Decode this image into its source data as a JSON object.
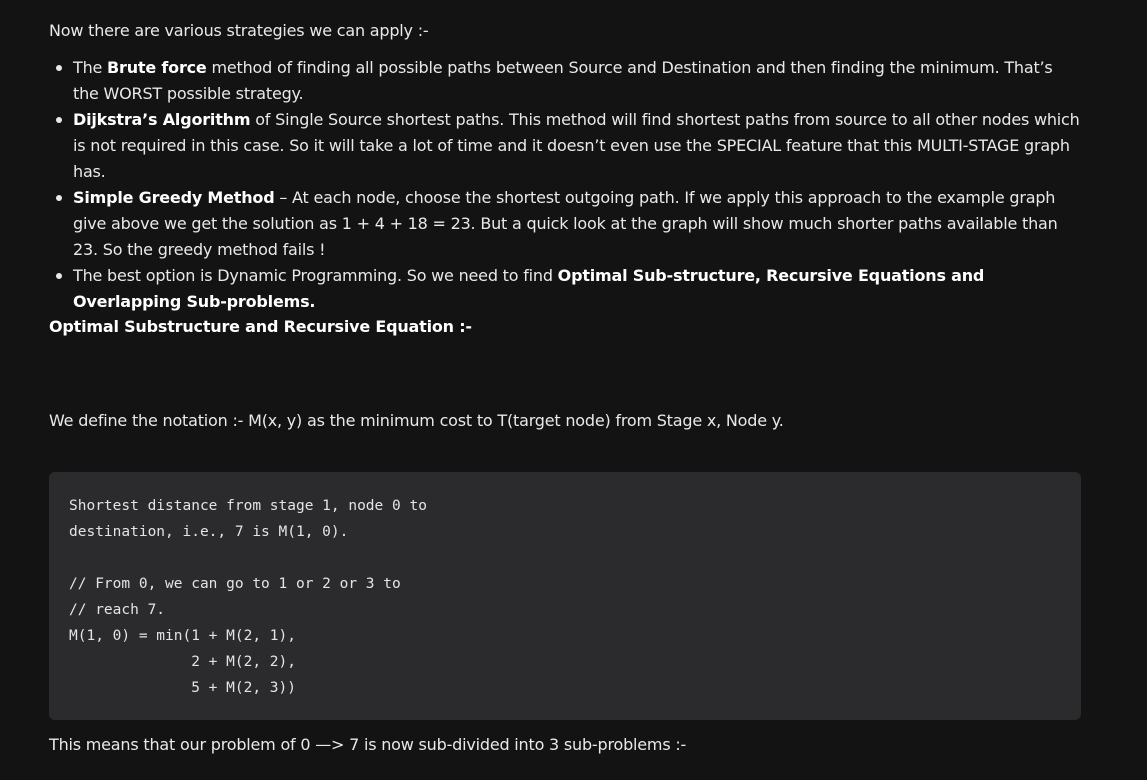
{
  "intro": "Now there are various strategies we can apply :-",
  "strategies": [
    {
      "pre": "The ",
      "bold": "Brute force",
      "post": " method of finding all possible paths between Source and Destination and then finding the minimum. That’s the WORST possible strategy."
    },
    {
      "pre": "",
      "bold": "Dijkstra’s Algorithm",
      "post": " of Single Source shortest paths. This method will find shortest paths from source to all other nodes which is not required in this case. So it will take a lot of time and it doesn’t even use the SPECIAL feature that this MULTI-STAGE graph has."
    },
    {
      "pre": "",
      "bold": "Simple Greedy Method",
      "post": " – At each node, choose the shortest outgoing path. If we apply this approach to the example graph give above we get the solution as 1 + 4 + 18 = 23. But a quick look at the graph will show much shorter paths available than 23. So the greedy method fails !"
    },
    {
      "pre": "The best option is Dynamic Programming. So we need to find ",
      "bold": "Optimal Sub-structure, Recursive Equations and Overlapping Sub-problems.",
      "post": ""
    }
  ],
  "heading": "Optimal Substructure and Recursive Equation :-",
  "notation": "We define the notation :- M(x, y) as the minimum cost to T(target node) from Stage x, Node y.",
  "code": "Shortest distance from stage 1, node 0 to\ndestination, i.e., 7 is M(1, 0).\n\n// From 0, we can go to 1 or 2 or 3 to\n// reach 7.\nM(1, 0) = min(1 + M(2, 1),\n              2 + M(2, 2),\n              5 + M(2, 3))",
  "outro": "This means that our problem of 0 —> 7 is now sub-divided into 3 sub-problems :-"
}
